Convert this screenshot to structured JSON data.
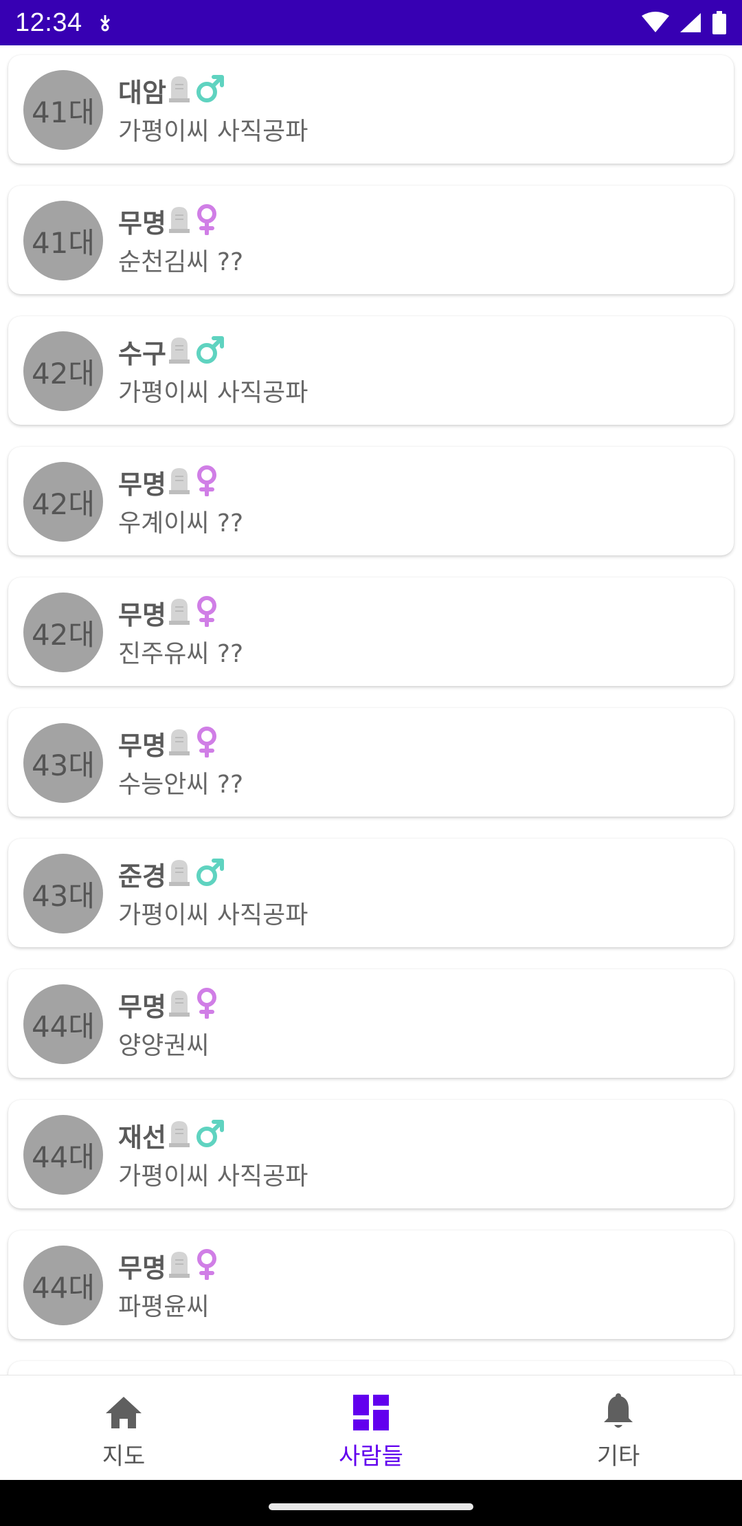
{
  "status_bar": {
    "time": "12:34",
    "icons": [
      "data-saver-icon",
      "wifi-icon",
      "cell-signal-icon",
      "battery-icon"
    ]
  },
  "people": [
    {
      "generation": "41대",
      "name": "대암",
      "gender": "male",
      "clan": "가평이씨 사직공파"
    },
    {
      "generation": "41대",
      "name": "무명",
      "gender": "female",
      "clan": "순천김씨 ??"
    },
    {
      "generation": "42대",
      "name": "수구",
      "gender": "male",
      "clan": "가평이씨 사직공파"
    },
    {
      "generation": "42대",
      "name": "무명",
      "gender": "female",
      "clan": "우계이씨 ??"
    },
    {
      "generation": "42대",
      "name": "무명",
      "gender": "female",
      "clan": "진주유씨 ??"
    },
    {
      "generation": "43대",
      "name": "무명",
      "gender": "female",
      "clan": "수능안씨 ??"
    },
    {
      "generation": "43대",
      "name": "준경",
      "gender": "male",
      "clan": "가평이씨 사직공파"
    },
    {
      "generation": "44대",
      "name": "무명",
      "gender": "female",
      "clan": "양양권씨"
    },
    {
      "generation": "44대",
      "name": "재선",
      "gender": "male",
      "clan": "가평이씨 사직공파"
    },
    {
      "generation": "44대",
      "name": "무명",
      "gender": "female",
      "clan": "파평윤씨"
    }
  ],
  "nav": [
    {
      "label": "지도",
      "icon": "home-icon",
      "active": false
    },
    {
      "label": "사람들",
      "icon": "dashboard-icon",
      "active": true
    },
    {
      "label": "기타",
      "icon": "bell-icon",
      "active": false
    }
  ],
  "colors": {
    "status_bar": "#3700b3",
    "accent": "#6200ee",
    "male": "#5fd3c0",
    "female": "#d07ee6",
    "avatar": "#a3a3a3"
  }
}
